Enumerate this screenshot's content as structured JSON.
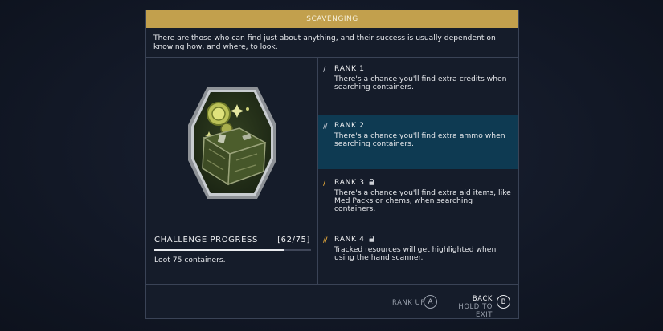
{
  "header": {
    "title": "SCAVENGING"
  },
  "skill": {
    "description": "There are those who can find just about anything, and their success is usually dependent on knowing how, and where, to look."
  },
  "challenge": {
    "title": "CHALLENGE PROGRESS",
    "count": "[62/75]",
    "current": 62,
    "total": 75,
    "description": "Loot 75 containers."
  },
  "ranks": [
    {
      "label": "RANK 1",
      "description": "There's a chance you'll find extra credits when searching containers.",
      "locked": false,
      "active": false,
      "pip_color": "#b8bcc6"
    },
    {
      "label": "RANK 2",
      "description": "There's a chance you'll find extra ammo when searching containers.",
      "locked": false,
      "active": true,
      "pip_color": "#b8bcc6"
    },
    {
      "label": "RANK 3",
      "description": "There's a chance you'll find extra aid items, like Med Packs or chems, when searching containers.",
      "locked": true,
      "active": false,
      "pip_color": "#e0a53a"
    },
    {
      "label": "RANK 4",
      "description": "Tracked resources will get highlighted when using the hand scanner.",
      "locked": true,
      "active": false,
      "pip_color": "#e0a53a"
    }
  ],
  "footer": {
    "rank_up_label": "RANK UP",
    "rank_up_button": "A",
    "back_label": "BACK",
    "hold_label": "HOLD TO EXIT",
    "back_button": "B"
  },
  "colors": {
    "header_bar": "#c2a04d",
    "active_rank_bg": "#0e3a52",
    "panel_bg": "#151c2a",
    "locked_pip": "#e0a53a"
  },
  "icons": {
    "badge": "scavenging-chest-badge-icon",
    "lock": "lock-icon"
  }
}
